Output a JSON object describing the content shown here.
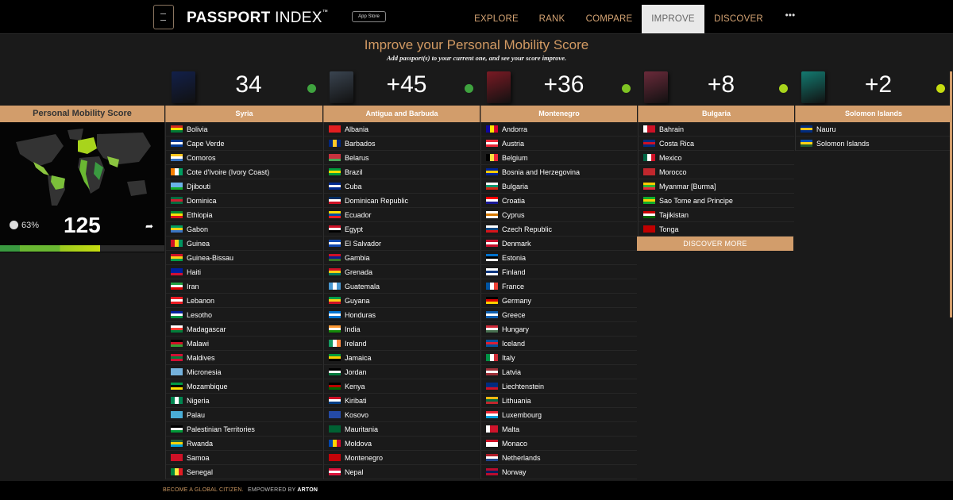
{
  "header": {
    "brand_bold": "PASSPORT",
    "brand_light": "INDEX",
    "trademark": "™",
    "app_store_label": "App Store",
    "nav": [
      {
        "label": "EXPLORE",
        "active": false
      },
      {
        "label": "RANK",
        "active": false
      },
      {
        "label": "COMPARE",
        "active": false
      },
      {
        "label": "IMPROVE",
        "active": true
      },
      {
        "label": "DISCOVER",
        "active": false
      },
      {
        "label": "•••",
        "active": false
      }
    ]
  },
  "page": {
    "title": "Improve your Personal Mobility Score",
    "subtitle": "Add passport(s) to your current one, and see your score improve."
  },
  "mobility": {
    "heading": "Personal Mobility Score",
    "percent": "63%",
    "score": "125",
    "bar_fill_fraction": 0.61
  },
  "passports": [
    {
      "country": "Syria",
      "score": "34",
      "dot_color": "#3fa33f",
      "cover_color": "#12204a",
      "countries": [
        {
          "name": "Bolivia",
          "flag": [
            "#d52b1e",
            "#f9e300",
            "#007934"
          ]
        },
        {
          "name": "Cape Verde",
          "flag": [
            "#003893",
            "#ffffff",
            "#003893"
          ]
        },
        {
          "name": "Comoros",
          "flag": [
            "#ffc61e",
            "#ffffff",
            "#3a75c4"
          ]
        },
        {
          "name": "Cote d'Ivoire (Ivory Coast)",
          "flag": [
            "#f77f00",
            "#ffffff",
            "#009e60"
          ],
          "vertical": true
        },
        {
          "name": "Djibouti",
          "flag": [
            "#6ab2e7",
            "#6ab2e7",
            "#12ad2b"
          ]
        },
        {
          "name": "Dominica",
          "flag": [
            "#006b3f",
            "#d41c30",
            "#006b3f"
          ]
        },
        {
          "name": "Ethiopia",
          "flag": [
            "#078930",
            "#fcdd09",
            "#da121a"
          ]
        },
        {
          "name": "Gabon",
          "flag": [
            "#009e60",
            "#fcd116",
            "#3a75c4"
          ]
        },
        {
          "name": "Guinea",
          "flag": [
            "#ce1126",
            "#fcd116",
            "#009460"
          ],
          "vertical": true
        },
        {
          "name": "Guinea-Bissau",
          "flag": [
            "#ce1126",
            "#fcd116",
            "#009e49"
          ]
        },
        {
          "name": "Haiti",
          "flag": [
            "#00209f",
            "#00209f",
            "#d21034"
          ]
        },
        {
          "name": "Iran",
          "flag": [
            "#239f40",
            "#ffffff",
            "#da0000"
          ]
        },
        {
          "name": "Lebanon",
          "flag": [
            "#ed1c24",
            "#ffffff",
            "#ed1c24"
          ]
        },
        {
          "name": "Lesotho",
          "flag": [
            "#00209f",
            "#ffffff",
            "#009543"
          ]
        },
        {
          "name": "Madagascar",
          "flag": [
            "#ffffff",
            "#fc3d32",
            "#007e3a"
          ]
        },
        {
          "name": "Malawi",
          "flag": [
            "#000000",
            "#ce1126",
            "#339e35"
          ]
        },
        {
          "name": "Maldives",
          "flag": [
            "#d21034",
            "#007e3a",
            "#d21034"
          ]
        },
        {
          "name": "Micronesia",
          "flag": [
            "#75b2dd",
            "#75b2dd",
            "#75b2dd"
          ]
        },
        {
          "name": "Mozambique",
          "flag": [
            "#009a44",
            "#000000",
            "#fce100"
          ]
        },
        {
          "name": "Nigeria",
          "flag": [
            "#008751",
            "#ffffff",
            "#008751"
          ],
          "vertical": true
        },
        {
          "name": "Palau",
          "flag": [
            "#4aadd6",
            "#4aadd6",
            "#4aadd6"
          ]
        },
        {
          "name": "Palestinian Territories",
          "flag": [
            "#000000",
            "#ffffff",
            "#009736"
          ]
        },
        {
          "name": "Rwanda",
          "flag": [
            "#20603d",
            "#fad201",
            "#00a1de"
          ]
        },
        {
          "name": "Samoa",
          "flag": [
            "#ce1126",
            "#ce1126",
            "#ce1126"
          ]
        },
        {
          "name": "Senegal",
          "flag": [
            "#00853f",
            "#fdef42",
            "#e31b23"
          ],
          "vertical": true
        }
      ]
    },
    {
      "country": "Antigua and Barbuda",
      "score": "+45",
      "dot_color": "#3fa33f",
      "cover_color": "#3a4450",
      "countries": [
        {
          "name": "Albania",
          "flag": [
            "#e41e20",
            "#e41e20",
            "#e41e20"
          ]
        },
        {
          "name": "Barbados",
          "flag": [
            "#00267f",
            "#ffc726",
            "#00267f"
          ],
          "vertical": true
        },
        {
          "name": "Belarus",
          "flag": [
            "#c8313e",
            "#c8313e",
            "#4aa657"
          ]
        },
        {
          "name": "Brazil",
          "flag": [
            "#009c3b",
            "#ffdf00",
            "#009c3b"
          ]
        },
        {
          "name": "Cuba",
          "flag": [
            "#002a8f",
            "#ffffff",
            "#002a8f"
          ]
        },
        {
          "name": "Dominican Republic",
          "flag": [
            "#002d62",
            "#ffffff",
            "#ce1126"
          ]
        },
        {
          "name": "Ecuador",
          "flag": [
            "#ffdd00",
            "#034ea2",
            "#ed1c24"
          ]
        },
        {
          "name": "Egypt",
          "flag": [
            "#ce1126",
            "#ffffff",
            "#000000"
          ]
        },
        {
          "name": "El Salvador",
          "flag": [
            "#0f47af",
            "#ffffff",
            "#0f47af"
          ]
        },
        {
          "name": "Gambia",
          "flag": [
            "#ce1126",
            "#0c1c8c",
            "#3a7728"
          ]
        },
        {
          "name": "Grenada",
          "flag": [
            "#ce1126",
            "#fcd116",
            "#007a5e"
          ]
        },
        {
          "name": "Guatemala",
          "flag": [
            "#4997d0",
            "#ffffff",
            "#4997d0"
          ],
          "vertical": true
        },
        {
          "name": "Guyana",
          "flag": [
            "#009e49",
            "#fcd116",
            "#ce1126"
          ]
        },
        {
          "name": "Honduras",
          "flag": [
            "#0073cf",
            "#ffffff",
            "#0073cf"
          ]
        },
        {
          "name": "India",
          "flag": [
            "#ff9933",
            "#ffffff",
            "#138808"
          ]
        },
        {
          "name": "Ireland",
          "flag": [
            "#169b62",
            "#ffffff",
            "#ff883e"
          ],
          "vertical": true
        },
        {
          "name": "Jamaica",
          "flag": [
            "#009b3a",
            "#fed100",
            "#000000"
          ]
        },
        {
          "name": "Jordan",
          "flag": [
            "#000000",
            "#ffffff",
            "#007a3d"
          ]
        },
        {
          "name": "Kenya",
          "flag": [
            "#000000",
            "#bb0000",
            "#006600"
          ]
        },
        {
          "name": "Kiribati",
          "flag": [
            "#ce1126",
            "#ffffff",
            "#003f87"
          ]
        },
        {
          "name": "Kosovo",
          "flag": [
            "#244aa5",
            "#244aa5",
            "#244aa5"
          ]
        },
        {
          "name": "Mauritania",
          "flag": [
            "#006233",
            "#006233",
            "#006233"
          ]
        },
        {
          "name": "Moldova",
          "flag": [
            "#0046ae",
            "#ffd200",
            "#cc092f"
          ],
          "vertical": true
        },
        {
          "name": "Montenegro",
          "flag": [
            "#c40308",
            "#c40308",
            "#c40308"
          ]
        },
        {
          "name": "Nepal",
          "flag": [
            "#dc143c",
            "#ffffff",
            "#dc143c"
          ]
        }
      ]
    },
    {
      "country": "Montenegro",
      "score": "+36",
      "dot_color": "#7fc423",
      "cover_color": "#7a1a24",
      "countries": [
        {
          "name": "Andorra",
          "flag": [
            "#10069f",
            "#fedf00",
            "#d50032"
          ],
          "vertical": true
        },
        {
          "name": "Austria",
          "flag": [
            "#ed2939",
            "#ffffff",
            "#ed2939"
          ]
        },
        {
          "name": "Belgium",
          "flag": [
            "#000000",
            "#fae042",
            "#ed2939"
          ],
          "vertical": true
        },
        {
          "name": "Bosnia and Herzegovina",
          "flag": [
            "#002395",
            "#fecb00",
            "#002395"
          ]
        },
        {
          "name": "Bulgaria",
          "flag": [
            "#ffffff",
            "#00966e",
            "#d62612"
          ]
        },
        {
          "name": "Croatia",
          "flag": [
            "#ff0000",
            "#ffffff",
            "#171796"
          ]
        },
        {
          "name": "Cyprus",
          "flag": [
            "#ffffff",
            "#d57800",
            "#ffffff"
          ]
        },
        {
          "name": "Czech Republic",
          "flag": [
            "#ffffff",
            "#11457e",
            "#d7141a"
          ]
        },
        {
          "name": "Denmark",
          "flag": [
            "#c8102e",
            "#ffffff",
            "#c8102e"
          ]
        },
        {
          "name": "Estonia",
          "flag": [
            "#0072ce",
            "#000000",
            "#ffffff"
          ]
        },
        {
          "name": "Finland",
          "flag": [
            "#ffffff",
            "#003580",
            "#ffffff"
          ]
        },
        {
          "name": "France",
          "flag": [
            "#0055a4",
            "#ffffff",
            "#ef4135"
          ],
          "vertical": true
        },
        {
          "name": "Germany",
          "flag": [
            "#000000",
            "#dd0000",
            "#ffce00"
          ]
        },
        {
          "name": "Greece",
          "flag": [
            "#0d5eaf",
            "#ffffff",
            "#0d5eaf"
          ]
        },
        {
          "name": "Hungary",
          "flag": [
            "#ce2939",
            "#ffffff",
            "#477050"
          ]
        },
        {
          "name": "Iceland",
          "flag": [
            "#02529c",
            "#dc1e35",
            "#02529c"
          ]
        },
        {
          "name": "Italy",
          "flag": [
            "#009246",
            "#ffffff",
            "#ce2b37"
          ],
          "vertical": true
        },
        {
          "name": "Latvia",
          "flag": [
            "#9e3039",
            "#ffffff",
            "#9e3039"
          ]
        },
        {
          "name": "Liechtenstein",
          "flag": [
            "#002b7f",
            "#002b7f",
            "#ce1126"
          ]
        },
        {
          "name": "Lithuania",
          "flag": [
            "#fdb913",
            "#006a44",
            "#c1272d"
          ]
        },
        {
          "name": "Luxembourg",
          "flag": [
            "#ed2939",
            "#ffffff",
            "#00a1de"
          ]
        },
        {
          "name": "Malta",
          "flag": [
            "#ffffff",
            "#cf142b",
            "#cf142b"
          ],
          "vertical": true
        },
        {
          "name": "Monaco",
          "flag": [
            "#ce1126",
            "#ffffff",
            "#ffffff"
          ]
        },
        {
          "name": "Netherlands",
          "flag": [
            "#ae1c28",
            "#ffffff",
            "#21468b"
          ]
        },
        {
          "name": "Norway",
          "flag": [
            "#ba0c2f",
            "#00205b",
            "#ba0c2f"
          ]
        }
      ]
    },
    {
      "country": "Bulgaria",
      "score": "+8",
      "dot_color": "#a8d41c",
      "cover_color": "#6a2a3a",
      "countries": [
        {
          "name": "Bahrain",
          "flag": [
            "#ffffff",
            "#ce1126",
            "#ce1126"
          ],
          "vertical": true
        },
        {
          "name": "Costa Rica",
          "flag": [
            "#002b7f",
            "#ce1126",
            "#002b7f"
          ]
        },
        {
          "name": "Mexico",
          "flag": [
            "#006847",
            "#ffffff",
            "#ce1126"
          ],
          "vertical": true
        },
        {
          "name": "Morocco",
          "flag": [
            "#c1272d",
            "#c1272d",
            "#c1272d"
          ]
        },
        {
          "name": "Myanmar [Burma]",
          "flag": [
            "#fecb00",
            "#34b233",
            "#ea2839"
          ]
        },
        {
          "name": "Sao Tome and Principe",
          "flag": [
            "#12ad2b",
            "#ffce00",
            "#12ad2b"
          ]
        },
        {
          "name": "Tajikistan",
          "flag": [
            "#cc0000",
            "#ffffff",
            "#006600"
          ]
        },
        {
          "name": "Tonga",
          "flag": [
            "#c10000",
            "#c10000",
            "#c10000"
          ]
        }
      ],
      "discover_more_label": "DISCOVER MORE"
    },
    {
      "country": "Solomon Islands",
      "score": "+2",
      "dot_color": "#c6dc10",
      "cover_color": "#137a70",
      "countries": [
        {
          "name": "Nauru",
          "flag": [
            "#002b7f",
            "#ffc61e",
            "#002b7f"
          ]
        },
        {
          "name": "Solomon Islands",
          "flag": [
            "#0051ba",
            "#fcd116",
            "#215b33"
          ]
        }
      ]
    }
  ],
  "footer": {
    "left": "BECOME A GLOBAL CITIZEN.",
    "middle": "EMPOWERED BY",
    "brand": "ARTON"
  }
}
